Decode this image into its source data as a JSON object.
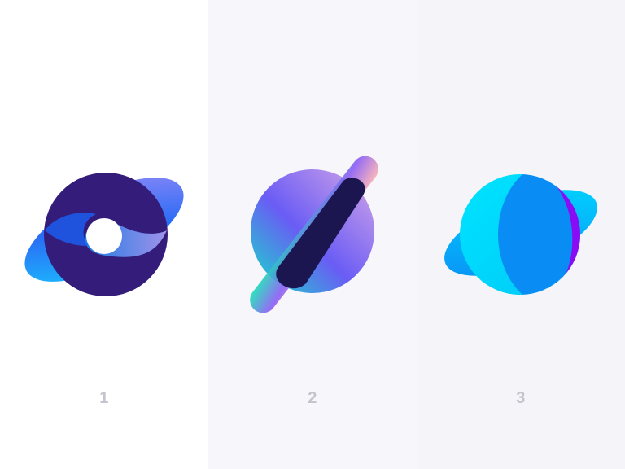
{
  "panels": [
    {
      "label": "1",
      "background": "#ffffff",
      "logo": "swirl-planet-logo"
    },
    {
      "label": "2",
      "background": "#f7f6fa",
      "logo": "gradient-planet-logo"
    },
    {
      "label": "3",
      "background": "#f5f4f8",
      "logo": "overlap-planet-logo"
    }
  ],
  "colors": {
    "deep_purple": "#341c7a",
    "navy": "#1c1650",
    "cyan": "#00d8ff",
    "blue": "#0a8cf5",
    "violet": "#8a0cf5",
    "lavender": "#9b8cf8",
    "label_gray": "#c4c4cc"
  }
}
